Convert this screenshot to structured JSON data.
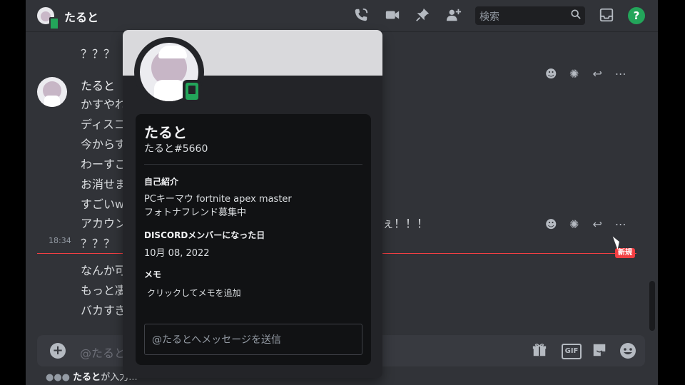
{
  "channel": {
    "title": "たると"
  },
  "search": {
    "placeholder": "検索"
  },
  "messages": {
    "author": "たると",
    "time": "18:34",
    "lines": [
      "？？？",
      "かすやれ",
      "ディスコ",
      "今からす",
      "わーすご",
      "お消せま",
      "すごいw",
      "アカウン",
      "？？？",
      "なんか可",
      "もっと凄",
      "バカすぎ"
    ],
    "line_tail": "ぇ！！！",
    "new_label": "新規"
  },
  "composer": {
    "placeholder": "@たると",
    "gif_label": "GIF"
  },
  "typing": {
    "name": "たると",
    "suffix": "が入力..."
  },
  "profile": {
    "name": "たると",
    "tag": "たると#5660",
    "about_title": "自己紹介",
    "about_line1": "PCキーマウ fortnite apex master",
    "about_line2": "フォトナフレンド募集中",
    "member_title": "DISCORDメンバーになった日",
    "member_date": "10月 08, 2022",
    "memo_title": "メモ",
    "memo_placeholder": "クリックしてメモを追加",
    "dm_placeholder": "@たるとへメッセージを送信"
  },
  "icons": [
    "phone-call-icon",
    "video-icon",
    "pin-icon",
    "add-member-icon",
    "search-icon",
    "inbox-icon",
    "help-icon",
    "add-reaction-icon",
    "super-reaction-icon",
    "reply-icon",
    "more-icon",
    "gift-icon",
    "gif-icon",
    "sticker-icon",
    "emoji-icon",
    "mobile-status-icon"
  ],
  "colors": {
    "online": "#23a55a",
    "new_divider": "#f23f43",
    "background": "#313338",
    "popout": "#232428"
  }
}
